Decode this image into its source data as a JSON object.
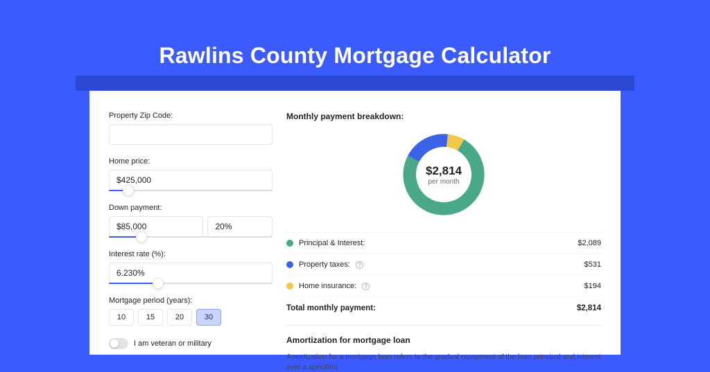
{
  "title": "Rawlins County Mortgage Calculator",
  "colors": {
    "principal": "#48a888",
    "taxes": "#3a63e8",
    "insurance": "#f0c94a"
  },
  "inputs": {
    "zip": {
      "label": "Property Zip Code:",
      "value": ""
    },
    "home_price": {
      "label": "Home price:",
      "value": "$425,000",
      "slider_pct": 12
    },
    "down_payment": {
      "label": "Down payment:",
      "value": "$85,000",
      "pct": "20%",
      "slider_pct": 20
    },
    "interest": {
      "label": "Interest rate (%):",
      "value": "6.230%",
      "slider_pct": 30
    },
    "period": {
      "label": "Mortgage period (years):",
      "options": [
        "10",
        "15",
        "20",
        "30"
      ],
      "selected": "30"
    },
    "veteran": {
      "label": "I am veteran or military",
      "on": false
    }
  },
  "breakdown": {
    "title": "Monthly payment breakdown:",
    "center_value": "$2,814",
    "center_sub": "per month",
    "rows": [
      {
        "swatch": "principal",
        "label": "Principal & Interest:",
        "help": false,
        "value": "$2,089"
      },
      {
        "swatch": "taxes",
        "label": "Property taxes:",
        "help": true,
        "value": "$531"
      },
      {
        "swatch": "insurance",
        "label": "Home insurance:",
        "help": true,
        "value": "$194"
      }
    ],
    "total_label": "Total monthly payment:",
    "total_value": "$2,814"
  },
  "amortization": {
    "title": "Amortization for mortgage loan",
    "text": "Amortization for a mortgage loan refers to the gradual repayment of the loan principal and interest over a specified"
  },
  "chart_data": {
    "type": "pie",
    "title": "Monthly payment breakdown",
    "series": [
      {
        "name": "Principal & Interest",
        "value": 2089,
        "color": "#48a888"
      },
      {
        "name": "Property taxes",
        "value": 531,
        "color": "#3a63e8"
      },
      {
        "name": "Home insurance",
        "value": 194,
        "color": "#f0c94a"
      }
    ],
    "total": 2814,
    "center_label": "$2,814 per month"
  }
}
